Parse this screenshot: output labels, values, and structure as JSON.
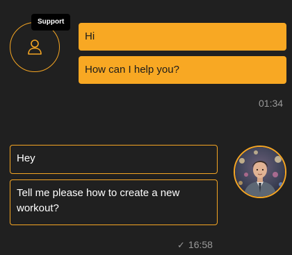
{
  "support": {
    "badge_label": "Support",
    "avatar_icon": "user-icon",
    "messages": [
      {
        "text": "Hi"
      },
      {
        "text": "How can I help you?"
      }
    ],
    "timestamp": "01:34"
  },
  "user": {
    "avatar": "user-photo",
    "messages": [
      {
        "text": "Hey"
      },
      {
        "text": "Tell me please how to create a new workout?"
      }
    ],
    "timestamp": "16:58",
    "status_icon": "check-icon"
  },
  "colors": {
    "accent": "#f8a823",
    "background": "#202020",
    "timestamp": "#9a9a9a"
  }
}
